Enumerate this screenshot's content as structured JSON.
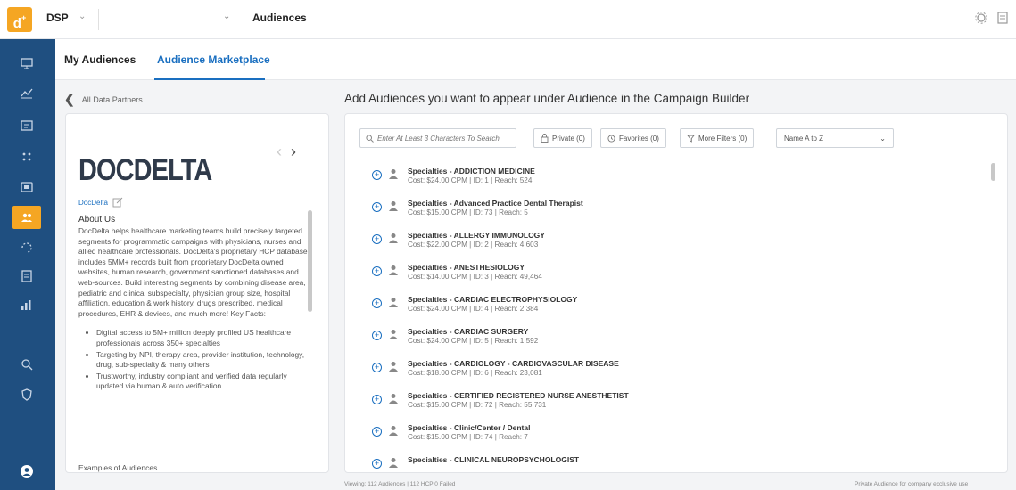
{
  "header": {
    "logo_text": "d",
    "app_name": "DSP",
    "page_name": "Audiences"
  },
  "tabs": [
    {
      "label": "My Audiences"
    },
    {
      "label": "Audience Marketplace"
    }
  ],
  "back_label": "All Data Partners",
  "partner": {
    "logo": "DOCDELTA",
    "name": "DocDelta",
    "about_title": "About Us",
    "about_text": "DocDelta helps healthcare marketing teams build precisely targeted segments for programmatic campaigns with physicians, nurses and allied healthcare professionals. DocDelta's proprietary HCP database includes 5MM+ records built from proprietary DocDelta owned websites, human research, government sanctioned databases and web-sources. Build interesting segments by combining disease area, pediatric and clinical subspecialty, physician group size, hospital affiliation, education & work history, drugs prescribed, medical procedures, EHR & devices, and much more! Key Facts:",
    "facts": [
      "Digital access to 5M+ million deeply profiled US healthcare professionals across 350+ specialties",
      "Targeting by NPI, therapy area, provider institution, technology, drug, sub-specialty & many others",
      "Trustworthy, industry compliant and verified data regularly updated via human & auto verification"
    ],
    "examples_label": "Examples of Audiences"
  },
  "main": {
    "title": "Add Audiences you want to appear under Audience in the Campaign Builder",
    "search_placeholder": "Enter At Least 3 Characters To Search",
    "private_label": "Private (0)",
    "favorites_label": "Favorites (0)",
    "more_filters_label": "More Filters (0)",
    "sort_label": "Name A to Z"
  },
  "audiences": [
    {
      "name": "Specialties - ADDICTION MEDICINE",
      "meta": "Cost: $24.00 CPM | ID: 1 | Reach: 524"
    },
    {
      "name": "Specialties - Advanced Practice Dental Therapist",
      "meta": "Cost: $15.00 CPM | ID: 73 | Reach: 5"
    },
    {
      "name": "Specialties - ALLERGY IMMUNOLOGY",
      "meta": "Cost: $22.00 CPM | ID: 2 | Reach: 4,603"
    },
    {
      "name": "Specialties - ANESTHESIOLOGY",
      "meta": "Cost: $14.00 CPM | ID: 3 | Reach: 49,464"
    },
    {
      "name": "Specialties - CARDIAC ELECTROPHYSIOLOGY",
      "meta": "Cost: $24.00 CPM | ID: 4 | Reach: 2,384"
    },
    {
      "name": "Specialties - CARDIAC SURGERY",
      "meta": "Cost: $24.00 CPM | ID: 5 | Reach: 1,592"
    },
    {
      "name": "Specialties - CARDIOLOGY - CARDIOVASCULAR DISEASE",
      "meta": "Cost: $18.00 CPM | ID: 6 | Reach: 23,081"
    },
    {
      "name": "Specialties - CERTIFIED REGISTERED NURSE ANESTHETIST",
      "meta": "Cost: $15.00 CPM | ID: 72 | Reach: 55,731"
    },
    {
      "name": "Specialties - Clinic/Center / Dental",
      "meta": "Cost: $15.00 CPM | ID: 74 | Reach: 7"
    },
    {
      "name": "Specialties - CLINICAL NEUROPSYCHOLOGIST",
      "meta": ""
    }
  ],
  "footer": {
    "left": "Viewing: 112 Audiences  |  112 HCP    0 Failed",
    "right": "Private Audience for company exclusive use"
  },
  "colors": {
    "sidebar": "#1f4f80",
    "accent": "#f5a623",
    "link": "#1a6fc0"
  },
  "sidebar_icons": [
    "dashboard-icon",
    "analytics-icon",
    "campaigns-icon",
    "creatives-icon",
    "inventory-icon",
    "audiences-icon",
    "pixels-icon",
    "reports-icon",
    "insights-icon",
    "search-tools-icon",
    "shield-icon",
    "user-icon"
  ]
}
